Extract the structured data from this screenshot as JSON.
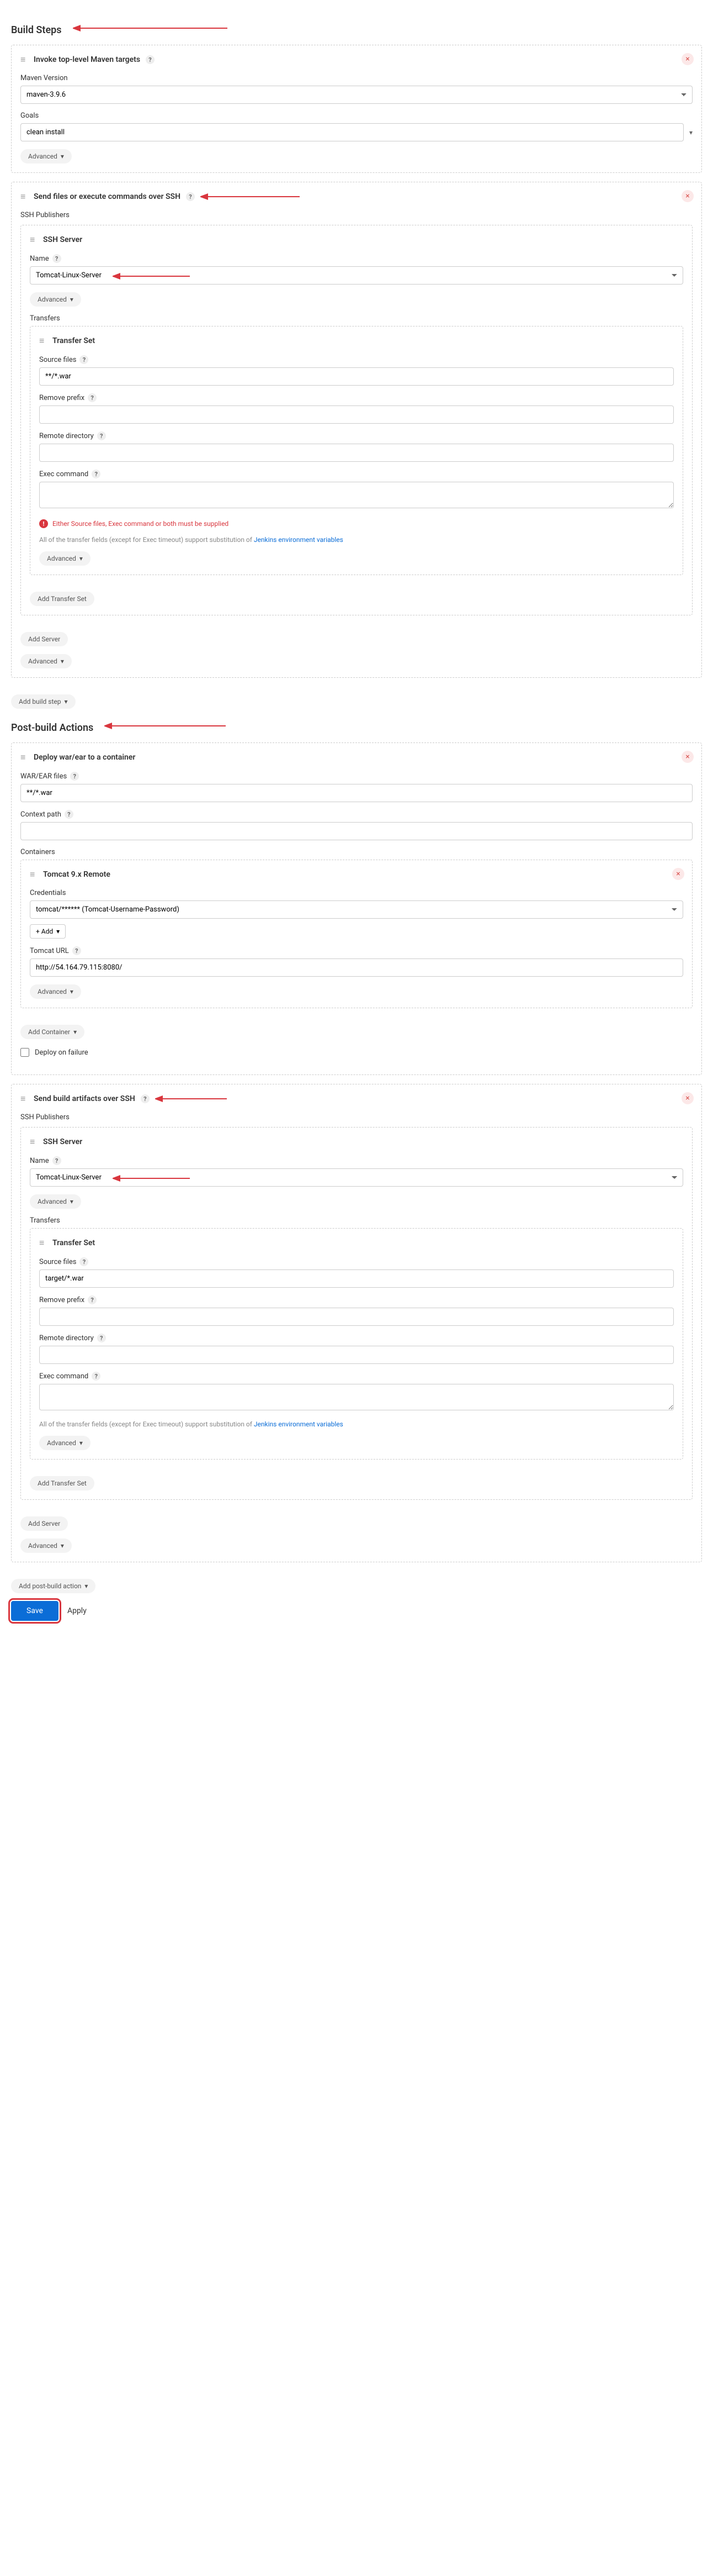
{
  "sections": {
    "buildStepsTitle": "Build Steps",
    "postBuildTitle": "Post-build Actions"
  },
  "maven": {
    "header": "Invoke top-level Maven targets",
    "versionLabel": "Maven Version",
    "versionValue": "maven-3.9.6",
    "goalsLabel": "Goals",
    "goalsValue": "clean install",
    "advanced": "Advanced"
  },
  "ssh1": {
    "header": "Send files or execute commands over SSH",
    "publishersLabel": "SSH Publishers",
    "serverHeader": "SSH Server",
    "nameLabel": "Name",
    "nameValue": "Tomcat-Linux-Server",
    "advanced": "Advanced",
    "transfersLabel": "Transfers",
    "transferSetHeader": "Transfer Set",
    "sourceFilesLabel": "Source files",
    "sourceFilesValue": "**/*.war",
    "removePrefixLabel": "Remove prefix",
    "removePrefixValue": "",
    "remoteDirLabel": "Remote directory",
    "remoteDirValue": "",
    "execCmdLabel": "Exec command",
    "execCmdValue": "",
    "errorText": "Either Source files, Exec command or both must be supplied",
    "noteText": "All of the transfer fields (except for Exec timeout) support substitution of ",
    "noteLink": "Jenkins environment variables",
    "addTransferSet": "Add Transfer Set",
    "addServer": "Add Server"
  },
  "addBuildStep": "Add build step",
  "deployWar": {
    "header": "Deploy war/ear to a container",
    "warLabel": "WAR/EAR files",
    "warValue": "**/*.war",
    "contextLabel": "Context path",
    "contextValue": "",
    "containersLabel": "Containers",
    "tomcatHeader": "Tomcat 9.x Remote",
    "credLabel": "Credentials",
    "credValue": "tomcat/****** (Tomcat-Username-Password)",
    "addCred": "+ Add",
    "urlLabel": "Tomcat URL",
    "urlValue": "http://54.164.79.115:8080/",
    "advanced": "Advanced",
    "addContainer": "Add Container",
    "deployFailureLabel": "Deploy on failure"
  },
  "ssh2": {
    "header": "Send build artifacts over SSH",
    "publishersLabel": "SSH Publishers",
    "serverHeader": "SSH Server",
    "nameLabel": "Name",
    "nameValue": "Tomcat-Linux-Server",
    "advanced": "Advanced",
    "transfersLabel": "Transfers",
    "transferSetHeader": "Transfer Set",
    "sourceFilesLabel": "Source files",
    "sourceFilesValue": "target/*.war",
    "removePrefixLabel": "Remove prefix",
    "removePrefixValue": "",
    "remoteDirLabel": "Remote directory",
    "remoteDirValue": "",
    "execCmdLabel": "Exec command",
    "execCmdValue": "",
    "noteText": "All of the transfer fields (except for Exec timeout) support substitution of ",
    "noteLink": "Jenkins environment variables",
    "addTransferSet": "Add Transfer Set",
    "addServer": "Add Server"
  },
  "addPostBuild": "Add post-build action",
  "footer": {
    "save": "Save",
    "apply": "Apply"
  }
}
